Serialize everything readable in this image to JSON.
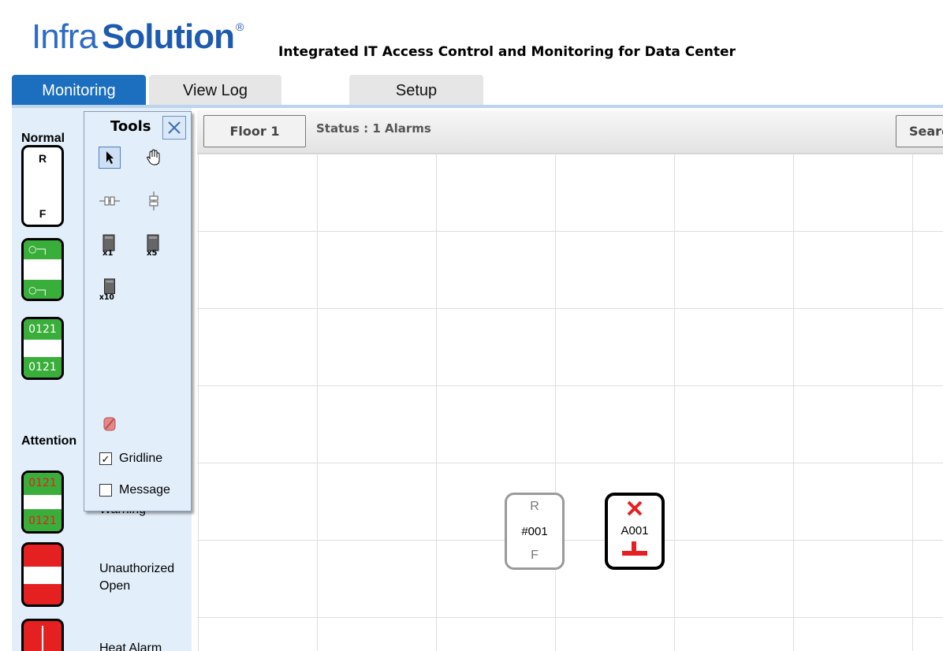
{
  "header": {
    "logo_part1": "Infra",
    "logo_part2": "Solution",
    "logo_mark": "®",
    "tagline": "Integrated IT Access Control and Monitoring for Data Center"
  },
  "tabs": [
    {
      "label": "Monitoring",
      "active": true
    },
    {
      "label": "View Log",
      "active": false
    },
    {
      "label": "Setup",
      "active": false
    }
  ],
  "legend": {
    "normal_heading": "Normal",
    "attention_heading": "Attention",
    "normal_icons": [
      {
        "type": "rf-door",
        "top_letter": "R",
        "bottom_letter": "F"
      },
      {
        "type": "key-door",
        "icon": "key-icon"
      },
      {
        "type": "code-door",
        "code": "0121"
      }
    ],
    "attention_items": [
      {
        "icon": "code-door-red",
        "code": "0121",
        "label": "Warning"
      },
      {
        "icon": "unauthorized-open-door",
        "label": "Unauthorized Open"
      },
      {
        "icon": "heat-alarm-door",
        "label": "Heat Alarm"
      }
    ]
  },
  "toolbar": {
    "floor_label": "Floor 1",
    "status_text": "Status : 1 Alarms",
    "search_label": "Search"
  },
  "tools": {
    "title": "Tools",
    "close_icon": "close-icon",
    "buttons": [
      {
        "icon": "pointer-icon",
        "selected": true
      },
      {
        "icon": "hand-icon",
        "selected": false
      },
      {
        "icon": "horizontal-door-icon",
        "selected": false
      },
      {
        "icon": "vertical-door-icon",
        "selected": false
      },
      {
        "icon": "rack-x1-icon",
        "label": "x1"
      },
      {
        "icon": "rack-x5-icon",
        "label": "x5"
      },
      {
        "icon": "rack-x10-icon",
        "label": "x10"
      },
      {
        "icon": "delete-icon"
      }
    ],
    "gridline_label": "Gridline",
    "gridline_checked": true,
    "message_label": "Message",
    "message_checked": false
  },
  "floor_items": [
    {
      "type": "reader",
      "top": "R",
      "id": "#001",
      "bottom": "F",
      "state": "normal"
    },
    {
      "type": "alarm",
      "id": "A001",
      "state": "alarm"
    }
  ],
  "colors": {
    "brand_blue": "#1e5bb0",
    "tab_active": "#1c6ebf",
    "sidebar_bg": "#e2eefa",
    "ok_green": "#3aae3a",
    "alarm_red": "#e52020"
  }
}
